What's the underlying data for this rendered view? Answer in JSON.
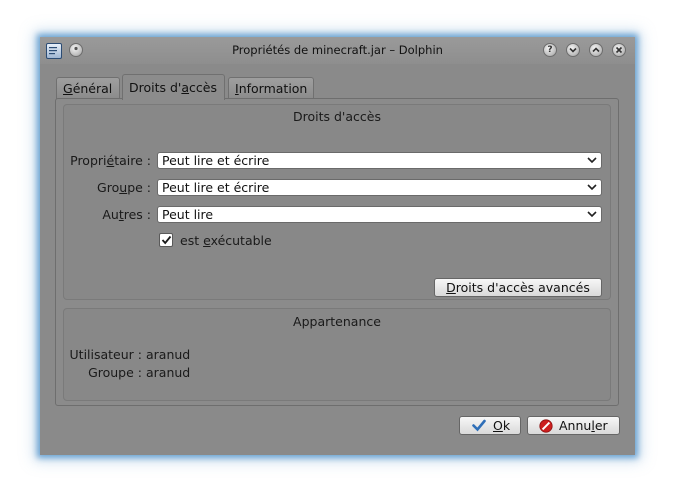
{
  "window": {
    "title": "Propriétés de minecraft.jar – Dolphin"
  },
  "titlebar_buttons": [
    {
      "name": "help-button",
      "glyph": "?"
    },
    {
      "name": "minimize-button",
      "glyph": "chevron-down"
    },
    {
      "name": "maximize-button",
      "glyph": "chevron-up"
    },
    {
      "name": "close-button",
      "glyph": "x"
    }
  ],
  "tabs": {
    "general": {
      "pre": "",
      "u": "G",
      "post": "énéral"
    },
    "permissions": {
      "pre": "Droits d'",
      "u": "a",
      "post": "ccès"
    },
    "information": {
      "pre": "",
      "u": "I",
      "post": "nformation"
    },
    "active": "permissions"
  },
  "permissions": {
    "title": "Droits d'accès",
    "owner": {
      "label_pre": "Propri",
      "label_u": "é",
      "label_post": "taire :",
      "value": "Peut lire et écrire"
    },
    "group": {
      "label_pre": "Gro",
      "label_u": "u",
      "label_post": "pe :",
      "value": "Peut lire et écrire"
    },
    "others": {
      "label_pre": "Au",
      "label_u": "t",
      "label_post": "res :",
      "value": "Peut lire"
    },
    "executable": {
      "pre": "est ",
      "u": "e",
      "post": "xécutable",
      "checked": true
    },
    "advanced_button": {
      "pre": "",
      "u": "D",
      "post": "roits d'accès avancés"
    }
  },
  "ownership": {
    "title": "Appartenance",
    "user_label": "Utilisateur :",
    "user_value": "aranud",
    "group_label": "Groupe :",
    "group_value": "aranud"
  },
  "buttons": {
    "ok": {
      "pre": "",
      "u": "O",
      "post": "k"
    },
    "cancel": {
      "pre": "Annu",
      "u": "l",
      "post": "er"
    }
  },
  "colors": {
    "window_bg": "#8a8a8a",
    "glow": "#468cc8",
    "ok_icon": "#2f6fb8",
    "cancel_icon": "#cc1f1f"
  }
}
